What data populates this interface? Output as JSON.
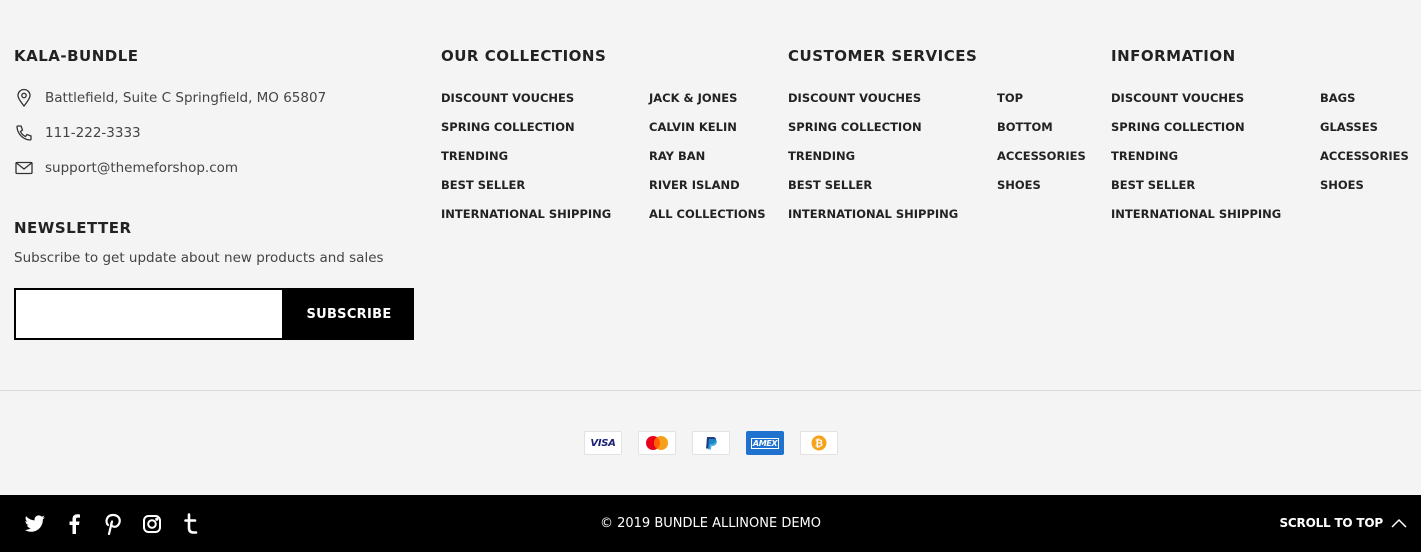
{
  "brand": {
    "heading": "KALA-BUNDLE",
    "address": "Battlefield, Suite C Springfield, MO 65807",
    "phone": "111-222-3333",
    "email": "support@themeforshop.com"
  },
  "newsletter": {
    "heading": "NEWSLETTER",
    "text": "Subscribe to get update about new products and sales",
    "input_placeholder": "",
    "button_label": "SUBSCRIBE"
  },
  "our_collections": {
    "heading": "OUR COLLECTIONS",
    "col1": [
      "DISCOUNT VOUCHES",
      "SPRING COLLECTION",
      "TRENDING",
      "BEST SELLER",
      "INTERNATIONAL SHIPPING"
    ],
    "col2": [
      "JACK & JONES",
      "CALVIN KELIN",
      "RAY BAN",
      "RIVER ISLAND",
      "ALL COLLECTIONS"
    ]
  },
  "customer_services": {
    "heading": "CUSTOMER SERVICES",
    "col1": [
      "DISCOUNT VOUCHES",
      "SPRING COLLECTION",
      "TRENDING",
      "BEST SELLER",
      "INTERNATIONAL SHIPPING"
    ],
    "col2": [
      "TOP",
      "BOTTOM",
      "ACCESSORIES",
      "SHOES"
    ]
  },
  "information": {
    "heading": "INFORMATION",
    "col1": [
      "DISCOUNT VOUCHES",
      "SPRING COLLECTION",
      "TRENDING",
      "BEST SELLER",
      "INTERNATIONAL SHIPPING"
    ],
    "col2": [
      "BAGS",
      "GLASSES",
      "ACCESSORIES",
      "SHOES"
    ]
  },
  "payments": [
    {
      "name": "visa-icon",
      "label": "VISA"
    },
    {
      "name": "mastercard-icon",
      "label": ""
    },
    {
      "name": "paypal-icon",
      "label": ""
    },
    {
      "name": "amex-icon",
      "label": "AMEX"
    },
    {
      "name": "bitcoin-icon",
      "label": ""
    }
  ],
  "bottom": {
    "social": [
      "twitter-icon",
      "facebook-icon",
      "pinterest-icon",
      "instagram-icon",
      "tumblr-icon"
    ],
    "copyright": "© 2019 BUNDLE ALLINONE DEMO",
    "scroll_label": "SCROLL TO TOP"
  },
  "colors": {
    "background": "#f4f4f4",
    "bottom_bar": "#000000",
    "text": "#222222",
    "amex": "#1f72cd",
    "bitcoin": "#f7a21b",
    "mastercard_red": "#eb001b",
    "mastercard_orange": "#f79e1b",
    "paypal_blue": "#253b80"
  }
}
